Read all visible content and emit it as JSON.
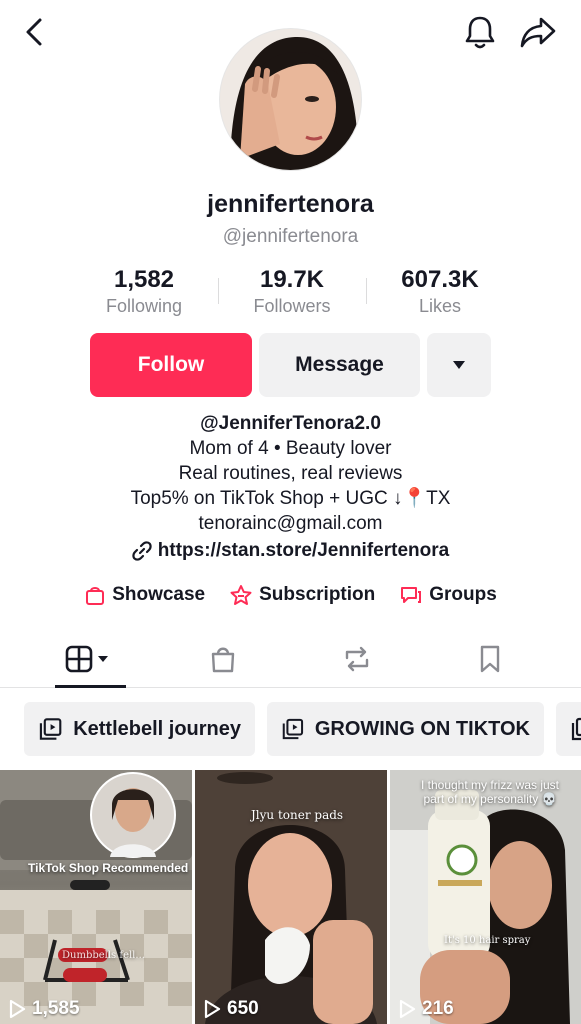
{
  "profile": {
    "display_name": "jennifertenora",
    "handle": "@jennifertenora"
  },
  "stats": [
    {
      "value": "1,582",
      "label": "Following"
    },
    {
      "value": "19.7K",
      "label": "Followers"
    },
    {
      "value": "607.3K",
      "label": "Likes"
    }
  ],
  "actions": {
    "follow_label": "Follow",
    "message_label": "Message"
  },
  "bio": {
    "lines": [
      "@JenniferTenora2.0",
      "Mom of 4 • Beauty lover",
      "Real routines, real reviews",
      "Top5% on TikTok Shop + UGC ↓📍TX",
      "tenorainc@gmail.com"
    ],
    "link": "https://stan.store/Jennifertenora"
  },
  "features": [
    {
      "label": "Showcase",
      "icon": "shopping-bag-icon"
    },
    {
      "label": "Subscription",
      "icon": "star-badge-icon"
    },
    {
      "label": "Groups",
      "icon": "chat-bubbles-icon"
    }
  ],
  "tabs": [
    {
      "name": "videos",
      "icon": "grid-icon",
      "active": true
    },
    {
      "name": "shop",
      "icon": "shopping-bag-icon"
    },
    {
      "name": "reposts",
      "icon": "repost-icon"
    },
    {
      "name": "saved",
      "icon": "bookmark-icon"
    }
  ],
  "playlists": [
    {
      "label": "Kettlebell journey"
    },
    {
      "label": "GROWING ON TIKTOK"
    }
  ],
  "videos": [
    {
      "views": "1,585",
      "caption": "TikTok Shop Recommended",
      "overlay": "Dumbbells fell..."
    },
    {
      "views": "650",
      "overlay": "Jlyu toner pads"
    },
    {
      "views": "216",
      "overlay": "I thought my frizz was just part of my personality 💀",
      "overlay2": "It's 10 hair spray"
    }
  ],
  "colors": {
    "accent": "#fe2c55",
    "text": "#161823",
    "secondary_text": "#8a8b91",
    "button_bg": "#f1f1f2"
  }
}
